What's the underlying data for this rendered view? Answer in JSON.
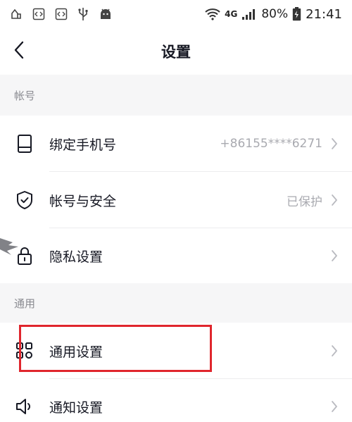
{
  "status_bar": {
    "network_label": "4G",
    "battery": "80%",
    "time": "21:41"
  },
  "header": {
    "title": "设置",
    "back_icon": "chevron-left-icon"
  },
  "sections": [
    {
      "title": "帐号",
      "items": [
        {
          "label": "绑定手机号",
          "value": "+86155****6271",
          "icon": "phone-icon"
        },
        {
          "label": "帐号与安全",
          "value": "已保护",
          "icon": "shield-check-icon"
        },
        {
          "label": "隐私设置",
          "value": "",
          "icon": "lock-icon"
        }
      ]
    },
    {
      "title": "通用",
      "items": [
        {
          "label": "通用设置",
          "value": "",
          "icon": "grid-icon"
        },
        {
          "label": "通知设置",
          "value": "",
          "icon": "speaker-icon"
        }
      ]
    }
  ],
  "colors": {
    "highlight": "#e0262d",
    "section_background": "#f6f6f7",
    "secondary_text": "#a9aab0"
  }
}
